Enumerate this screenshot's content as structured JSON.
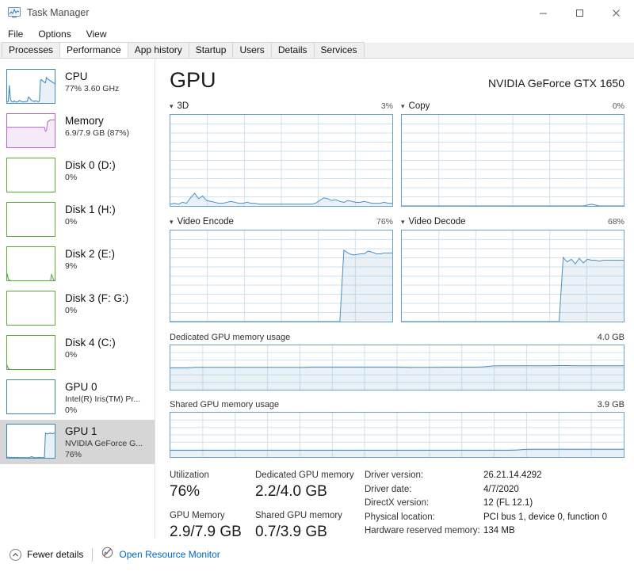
{
  "window": {
    "title": "Task Manager",
    "icon": "task-manager-icon",
    "controls": {
      "minimize": "—",
      "maximize": "□",
      "close": "✕"
    }
  },
  "menu": {
    "items": [
      "File",
      "Options",
      "View"
    ]
  },
  "tabs": {
    "items": [
      "Processes",
      "Performance",
      "App history",
      "Startup",
      "Users",
      "Details",
      "Services"
    ],
    "active": "Performance"
  },
  "sidebar": {
    "items": [
      {
        "title": "CPU",
        "sub": "77% 3.60 GHz",
        "sub2": "",
        "color": "#3a86b8",
        "selected": false
      },
      {
        "title": "Memory",
        "sub": "6.9/7.9 GB (87%)",
        "sub2": "",
        "color": "#b565c8",
        "selected": false
      },
      {
        "title": "Disk 0 (D:)",
        "sub": "0%",
        "sub2": "",
        "color": "#5ba83a",
        "selected": false
      },
      {
        "title": "Disk 1 (H:)",
        "sub": "0%",
        "sub2": "",
        "color": "#5ba83a",
        "selected": false
      },
      {
        "title": "Disk 2 (E:)",
        "sub": "9%",
        "sub2": "",
        "color": "#5ba83a",
        "selected": false
      },
      {
        "title": "Disk 3 (F: G:)",
        "sub": "0%",
        "sub2": "",
        "color": "#5ba83a",
        "selected": false
      },
      {
        "title": "Disk 4 (C:)",
        "sub": "0%",
        "sub2": "",
        "color": "#5ba83a",
        "selected": false
      },
      {
        "title": "GPU 0",
        "sub": "Intel(R) Iris(TM) Pr...",
        "sub2": "0%",
        "color": "#3a86b8",
        "selected": false
      },
      {
        "title": "GPU 1",
        "sub": "NVIDIA GeForce G...",
        "sub2": "76%",
        "color": "#3a86b8",
        "selected": true
      }
    ]
  },
  "main": {
    "title": "GPU",
    "device": "NVIDIA GeForce GTX 1650",
    "engine_graphs": [
      {
        "name": "3D",
        "value": "3%"
      },
      {
        "name": "Copy",
        "value": "0%"
      },
      {
        "name": "Video Encode",
        "value": "76%"
      },
      {
        "name": "Video Decode",
        "value": "68%"
      }
    ],
    "memory_graphs": [
      {
        "name": "Dedicated GPU memory usage",
        "max": "4.0 GB"
      },
      {
        "name": "Shared GPU memory usage",
        "max": "3.9 GB"
      }
    ],
    "stats": [
      {
        "label": "Utilization",
        "value": "76%"
      },
      {
        "label": "GPU Memory",
        "value": "2.9/7.9 GB"
      },
      {
        "label": "Dedicated GPU memory",
        "value": "2.2/4.0 GB"
      },
      {
        "label": "Shared GPU memory",
        "value": "0.7/3.9 GB"
      }
    ],
    "info": [
      {
        "key": "Driver version:",
        "value": "26.21.14.4292"
      },
      {
        "key": "Driver date:",
        "value": "4/7/2020"
      },
      {
        "key": "DirectX version:",
        "value": "12 (FL 12.1)"
      },
      {
        "key": "Physical location:",
        "value": "PCI bus 1, device 0, function 0"
      },
      {
        "key": "Hardware reserved memory:",
        "value": "134 MB"
      }
    ]
  },
  "footer": {
    "fewer_details": "Fewer details",
    "fewer_icon": "chevron-up-circle-icon",
    "resource_monitor": "Open Resource Monitor",
    "resource_icon": "resource-monitor-icon"
  },
  "chart_data": [
    {
      "type": "line",
      "title": "3D",
      "ylim": [
        0,
        100
      ],
      "current": 3,
      "values": [
        2,
        3,
        2,
        4,
        3,
        9,
        14,
        8,
        11,
        6,
        5,
        4,
        3,
        3,
        4,
        5,
        4,
        3,
        3,
        4,
        3,
        3,
        2,
        2,
        2,
        2,
        2,
        2,
        2,
        2,
        2,
        2,
        2,
        2,
        2,
        2,
        3,
        6,
        9,
        8,
        6,
        7,
        5,
        4,
        6,
        5,
        4,
        4,
        5,
        4,
        3,
        3,
        3,
        4,
        3,
        3
      ]
    },
    {
      "type": "line",
      "title": "Copy",
      "ylim": [
        0,
        100
      ],
      "current": 0,
      "values": [
        0,
        0,
        0,
        0,
        0,
        0,
        0,
        0,
        0,
        0,
        0,
        0,
        0,
        0,
        0,
        0,
        0,
        0,
        0,
        0,
        0,
        0,
        0,
        0,
        0,
        0,
        0,
        0,
        0,
        0,
        0,
        0,
        0,
        0,
        0,
        0,
        0,
        0,
        0,
        0,
        0,
        0,
        0,
        0,
        0,
        0,
        1,
        2,
        1,
        0,
        0,
        0,
        0,
        0,
        0,
        0
      ]
    },
    {
      "type": "line",
      "title": "Video Encode",
      "ylim": [
        0,
        100
      ],
      "current": 76,
      "values": [
        0,
        0,
        0,
        0,
        0,
        0,
        0,
        0,
        0,
        0,
        0,
        0,
        0,
        0,
        0,
        0,
        0,
        0,
        0,
        0,
        0,
        0,
        0,
        0,
        0,
        0,
        0,
        0,
        0,
        0,
        0,
        0,
        0,
        0,
        0,
        0,
        0,
        0,
        0,
        0,
        0,
        0,
        0,
        79,
        76,
        74,
        74,
        75,
        75,
        78,
        77,
        75,
        75,
        76,
        76,
        76
      ]
    },
    {
      "type": "line",
      "title": "Video Decode",
      "ylim": [
        0,
        100
      ],
      "current": 68,
      "values": [
        0,
        0,
        0,
        0,
        0,
        0,
        0,
        0,
        0,
        0,
        0,
        0,
        0,
        0,
        0,
        0,
        0,
        0,
        0,
        0,
        0,
        0,
        0,
        0,
        0,
        0,
        0,
        0,
        0,
        0,
        0,
        0,
        0,
        0,
        0,
        0,
        0,
        0,
        0,
        0,
        71,
        66,
        69,
        64,
        70,
        65,
        69,
        68,
        68,
        67,
        68,
        68,
        68,
        68,
        68,
        68
      ]
    },
    {
      "type": "area",
      "title": "Dedicated GPU memory usage",
      "ylim": [
        0,
        4.0
      ],
      "ylabel": "GB",
      "current": 2.2,
      "values": [
        2.0,
        2.0,
        2.0,
        2.05,
        2.05,
        2.05,
        2.05,
        2.05,
        2.05,
        2.05,
        2.05,
        2.05,
        2.05,
        2.05,
        2.05,
        2.05,
        2.05,
        2.08,
        2.08,
        2.08,
        2.08,
        2.08,
        2.08,
        2.08,
        2.08,
        2.08,
        2.08,
        2.08,
        2.08,
        2.05,
        2.05,
        2.05,
        2.05,
        2.07,
        2.07,
        2.07,
        2.07,
        2.07,
        2.1,
        2.18,
        2.2,
        2.2,
        2.2,
        2.2,
        2.2,
        2.2,
        2.2,
        2.22,
        2.22,
        2.2,
        2.2,
        2.2,
        2.2,
        2.2,
        2.2,
        2.2
      ]
    },
    {
      "type": "area",
      "title": "Shared GPU memory usage",
      "ylim": [
        0,
        3.9
      ],
      "ylabel": "GB",
      "current": 0.7,
      "values": [
        0.6,
        0.6,
        0.6,
        0.6,
        0.6,
        0.6,
        0.6,
        0.6,
        0.6,
        0.6,
        0.6,
        0.6,
        0.6,
        0.6,
        0.6,
        0.6,
        0.6,
        0.6,
        0.6,
        0.6,
        0.6,
        0.6,
        0.6,
        0.6,
        0.6,
        0.6,
        0.6,
        0.6,
        0.6,
        0.6,
        0.6,
        0.6,
        0.6,
        0.6,
        0.6,
        0.6,
        0.6,
        0.6,
        0.6,
        0.6,
        0.6,
        0.6,
        0.62,
        0.68,
        0.7,
        0.7,
        0.7,
        0.7,
        0.7,
        0.7,
        0.7,
        0.7,
        0.7,
        0.7,
        0.7,
        0.7
      ]
    }
  ],
  "thumbs": {
    "cpu": [
      8,
      6,
      7,
      55,
      18,
      7,
      6,
      5,
      9,
      6,
      5,
      6,
      7,
      10,
      8,
      7,
      6,
      5,
      6,
      7,
      6,
      8,
      20,
      18,
      14,
      10,
      9,
      8,
      7,
      9,
      8,
      7,
      6,
      8,
      70,
      72,
      68,
      66,
      64,
      62,
      78,
      74,
      72,
      70,
      68,
      66,
      64,
      62,
      60,
      58
    ],
    "memory": [
      62,
      62,
      62,
      62,
      62,
      62,
      62,
      62,
      62,
      62,
      62,
      62,
      62,
      62,
      62,
      62,
      62,
      62,
      62,
      62,
      62,
      62,
      62,
      62,
      62,
      62,
      62,
      62,
      62,
      62,
      62,
      62,
      62,
      62,
      62,
      62,
      62,
      62,
      62,
      50,
      52,
      78,
      80,
      82,
      84,
      83,
      84,
      84,
      84,
      84
    ],
    "disk0": [
      0,
      0,
      0,
      0,
      0,
      0,
      0,
      0,
      0,
      0,
      0,
      0,
      0,
      0,
      0,
      0,
      0,
      0,
      0,
      0,
      0,
      0,
      0,
      0,
      0,
      0,
      0,
      0,
      0,
      0,
      0,
      0,
      0,
      0,
      0,
      0,
      0,
      0,
      0,
      0,
      0,
      0,
      0,
      0,
      0,
      0,
      1,
      2,
      1,
      0
    ],
    "disk1": [
      0,
      0,
      0,
      0,
      0,
      0,
      0,
      0,
      0,
      0,
      0,
      0,
      0,
      0,
      0,
      0,
      0,
      0,
      0,
      0,
      0,
      0,
      0,
      0,
      0,
      0,
      0,
      0,
      0,
      0,
      0,
      0,
      0,
      0,
      0,
      0,
      0,
      0,
      0,
      0,
      0,
      0,
      0,
      0,
      0,
      0,
      0,
      0,
      0,
      0
    ],
    "disk2": [
      3,
      22,
      6,
      3,
      2,
      1,
      1,
      1,
      1,
      1,
      1,
      1,
      1,
      1,
      1,
      1,
      1,
      1,
      1,
      1,
      1,
      1,
      1,
      1,
      1,
      1,
      1,
      1,
      1,
      1,
      1,
      1,
      1,
      1,
      1,
      1,
      1,
      1,
      1,
      1,
      1,
      1,
      1,
      1,
      1,
      20,
      14,
      4,
      2,
      1
    ],
    "disk3": [
      0,
      0,
      0,
      0,
      0,
      0,
      0,
      0,
      0,
      0,
      0,
      0,
      0,
      0,
      0,
      0,
      0,
      0,
      0,
      0,
      0,
      0,
      0,
      0,
      0,
      0,
      0,
      0,
      0,
      0,
      0,
      0,
      0,
      0,
      0,
      0,
      0,
      0,
      0,
      0,
      0,
      0,
      0,
      0,
      0,
      0,
      0,
      0,
      0,
      0
    ],
    "disk4": [
      2,
      12,
      5,
      2,
      1,
      1,
      1,
      1,
      1,
      1,
      1,
      1,
      1,
      1,
      1,
      1,
      1,
      1,
      1,
      1,
      1,
      1,
      1,
      1,
      1,
      1,
      1,
      1,
      1,
      1,
      1,
      1,
      1,
      1,
      1,
      1,
      1,
      1,
      1,
      1,
      1,
      1,
      1,
      1,
      1,
      1,
      1,
      1,
      1,
      1
    ],
    "gpu0": [
      0,
      0,
      0,
      0,
      0,
      0,
      0,
      0,
      0,
      0,
      0,
      0,
      0,
      0,
      0,
      0,
      0,
      0,
      0,
      0,
      0,
      0,
      0,
      0,
      0,
      0,
      0,
      0,
      0,
      0,
      0,
      0,
      0,
      0,
      0,
      0,
      0,
      0,
      0,
      0,
      0,
      0,
      0,
      0,
      0,
      0,
      0,
      0,
      0,
      0
    ],
    "gpu1": [
      4,
      3,
      5,
      4,
      3,
      4,
      3,
      3,
      4,
      3,
      3,
      4,
      3,
      3,
      3,
      3,
      3,
      3,
      3,
      3,
      3,
      3,
      3,
      3,
      4,
      6,
      5,
      4,
      3,
      3,
      3,
      3,
      3,
      4,
      3,
      3,
      3,
      3,
      3,
      76,
      74,
      73,
      75,
      74,
      76,
      75,
      74,
      75,
      76,
      76
    ]
  }
}
